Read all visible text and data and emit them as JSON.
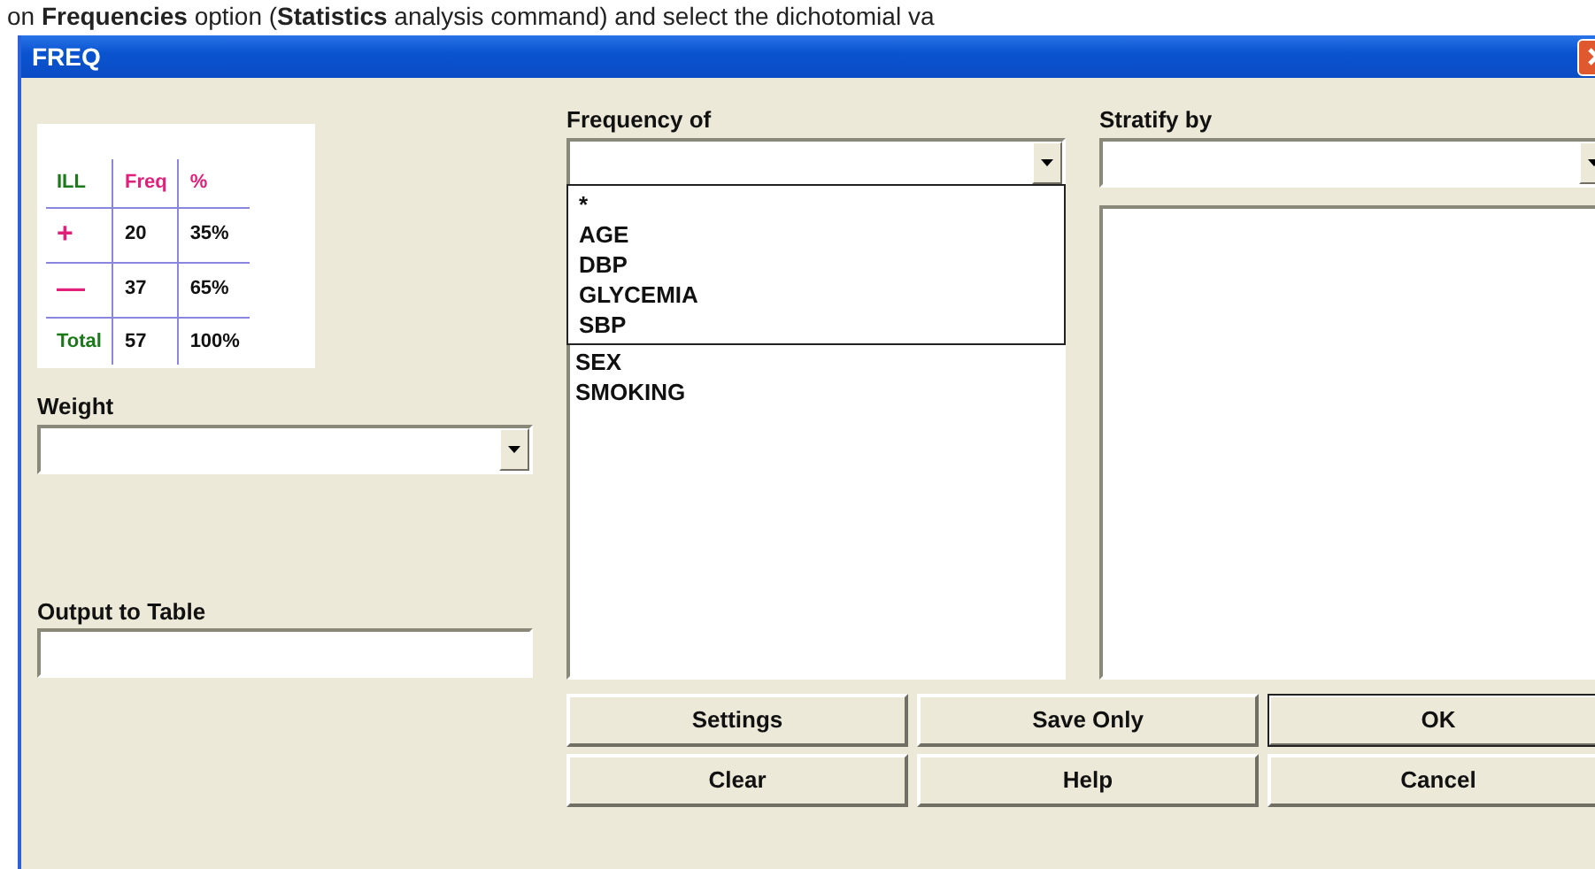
{
  "caption": "on **Frequencies** option (**Statistics** analysis command) and select the dichotomial va",
  "window": {
    "title": "FREQ"
  },
  "legend_table": {
    "rows": [
      {
        "cells": [
          {
            "text": "ILL",
            "color": "#1a7a1a"
          },
          {
            "text": "Freq",
            "color": "#e0207a"
          },
          {
            "text": "%",
            "color": "#e0207a"
          }
        ]
      },
      {
        "cells": [
          {
            "text": "+",
            "color": "#e0207a"
          },
          {
            "text": "20"
          },
          {
            "text": "35%"
          }
        ]
      },
      {
        "cells": [
          {
            "text": "—",
            "color": "#e0207a"
          },
          {
            "text": "37"
          },
          {
            "text": "65%"
          }
        ]
      },
      {
        "cells": [
          {
            "text": "Total",
            "color": "#1a7a1a"
          },
          {
            "text": "57"
          },
          {
            "text": "100%"
          }
        ]
      }
    ]
  },
  "weight": {
    "label": "Weight"
  },
  "output_to_table": {
    "label": "Output to Table"
  },
  "frequency_of": {
    "label": "Frequency of",
    "expanded": true,
    "dropdown_items": [
      "*",
      "AGE",
      "DBP",
      "GLYCEMIA",
      "SBP"
    ],
    "list_items": [
      "SEX",
      "SMOKING"
    ]
  },
  "stratify_by": {
    "label": "Stratify by"
  },
  "buttons": [
    {
      "label": "Settings",
      "default": false
    },
    {
      "label": "Save Only",
      "default": false
    },
    {
      "label": "OK",
      "default": true
    },
    {
      "label": "Clear",
      "default": false
    },
    {
      "label": "Help",
      "default": false
    },
    {
      "label": "Cancel",
      "default": false
    }
  ]
}
